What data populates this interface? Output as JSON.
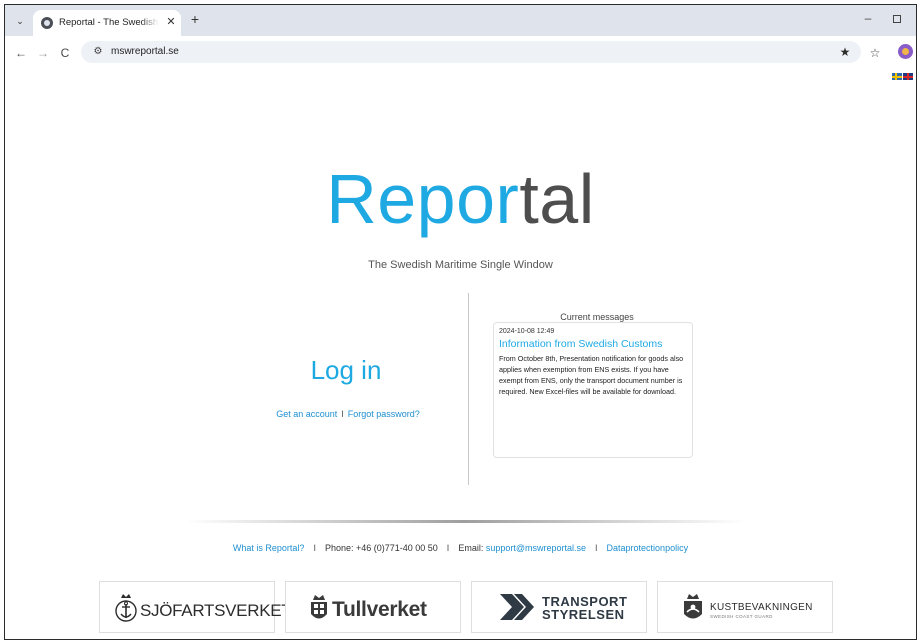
{
  "browser": {
    "tab_title": "Reportal - The Swedish Single Window",
    "tab_menu_icon": "chevron-down-icon",
    "close_glyph": "✕",
    "new_tab_glyph": "+",
    "minimize_glyph": "–",
    "back_glyph": "←",
    "forward_glyph": "→",
    "reload_glyph": "C",
    "site_info_glyph": "⚙",
    "url": "mswreportal.se",
    "star_glyph": "★",
    "favorites_glyph": "☆"
  },
  "page": {
    "logo_part_a": "Repor",
    "logo_part_b": "tal",
    "tagline": "The Swedish Maritime Single Window",
    "login": {
      "title": "Log in",
      "get_account": "Get an account",
      "separator": "I",
      "forgot_password": "Forgot password?"
    },
    "messages": {
      "heading": "Current messages",
      "items": [
        {
          "date": "2024-10-08 12:49",
          "title": "Information from Swedish Customs",
          "body": "From October 8th, Presentation notification for goods also applies when exemption from ENS exists. If you have exempt from ENS, only the transport document number is required. New Excel-files will be available for download."
        }
      ]
    },
    "footer": {
      "what_is": "What is Reportal?",
      "sep": "I",
      "phone": "Phone: +46 (0)771-40 00 50",
      "email_label": "Email: ",
      "email": "support@mswreportal.se",
      "dataprotection": "Dataprotectionpolicy"
    },
    "partners": {
      "sjofartsverket": "SJÖFARTSVERKET",
      "tullverket": "Tullverket",
      "transport_line1": "TRANSPORT",
      "transport_line2": "STYRELSEN",
      "kustbevakningen": "KUSTBEVAKNINGEN",
      "kustbevakningen_sub": "SWEDISH COAST GUARD"
    }
  },
  "colors": {
    "brand_blue": "#1ea9e3",
    "link_blue": "#1e8fd0",
    "logo_grey": "#4e4e4e"
  }
}
